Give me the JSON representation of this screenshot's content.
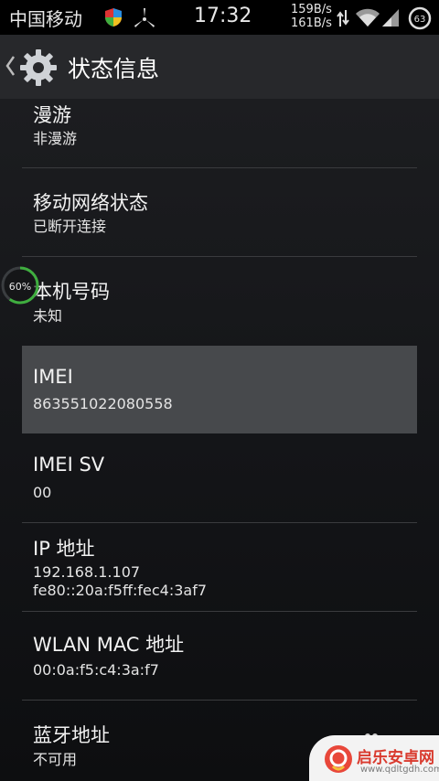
{
  "status_bar": {
    "carrier": "中国移动",
    "time": "17:32",
    "upload_speed": "159B/s",
    "download_speed": "161B/s",
    "battery_level": "63",
    "icons": [
      "shield-icon",
      "fan-icon",
      "data-arrows-icon",
      "wifi-icon",
      "signal-icon",
      "battery-icon"
    ]
  },
  "action_bar": {
    "title": "状态信息",
    "icons": [
      "back-chevron-icon",
      "settings-gear-icon"
    ]
  },
  "items": [
    {
      "title": "漫游",
      "values": [
        "非漫游"
      ]
    },
    {
      "title": "移动网络状态",
      "values": [
        "已断开连接"
      ]
    },
    {
      "title": "本机号码",
      "values": [
        "未知"
      ]
    },
    {
      "title": "IMEI",
      "values": [
        "863551022080558"
      ]
    },
    {
      "title": "IMEI SV",
      "values": [
        "00"
      ]
    },
    {
      "title": "IP 地址",
      "values": [
        "192.168.1.107",
        "fe80::20a:f5ff:fec4:3af7"
      ]
    },
    {
      "title": "WLAN MAC 地址",
      "values": [
        "00:0a:f5:c4:3a:f7"
      ]
    },
    {
      "title": "蓝牙地址",
      "values": [
        "不可用"
      ]
    }
  ],
  "progress_overlay": {
    "label": "60%",
    "value": 0.6
  },
  "watermark": {
    "name": "启乐安卓网",
    "url": "www.qdltgdh.com"
  },
  "colors": {
    "accent_green": "#3fae3f",
    "selected_row": "#47494c",
    "background": "#141518"
  }
}
